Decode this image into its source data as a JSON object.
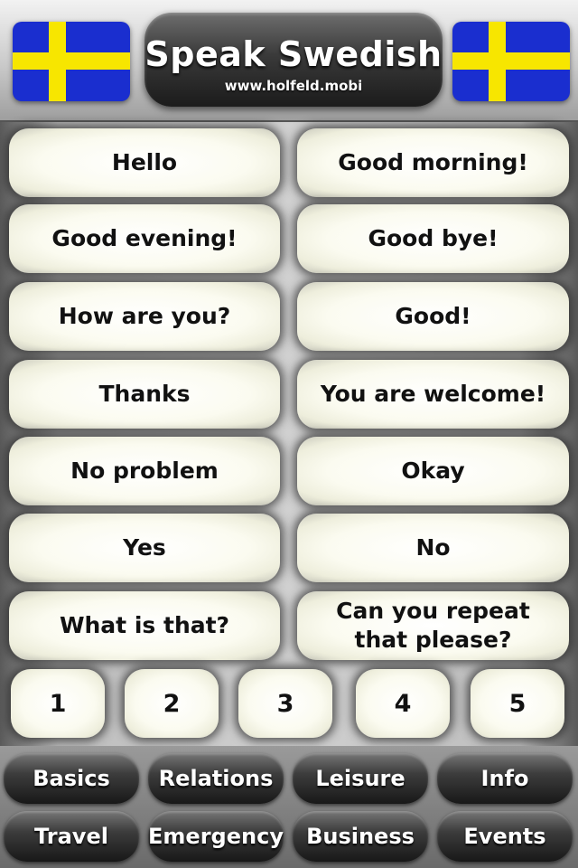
{
  "header": {
    "title": "Speak Swedish",
    "url": "www.holfeld.mobi",
    "flag_colors": {
      "blue": "#1a2ecf",
      "yellow": "#f7e600"
    }
  },
  "phrases": [
    "Hello",
    "Good morning!",
    "Good evening!",
    "Good bye!",
    "How are you?",
    "Good!",
    "Thanks",
    "You are welcome!",
    "No problem",
    "Okay",
    "Yes",
    "No",
    "What is that?",
    "Can you repeat that please?"
  ],
  "pages": [
    "1",
    "2",
    "3",
    "4",
    "5"
  ],
  "categories": [
    "Basics",
    "Relations",
    "Leisure",
    "Info",
    "Travel",
    "Emergency",
    "Business",
    "Events"
  ]
}
